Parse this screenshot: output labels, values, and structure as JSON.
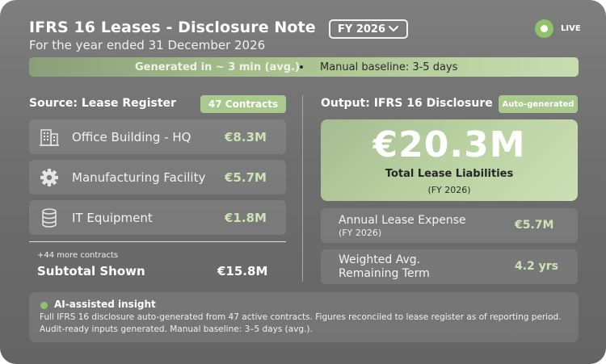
{
  "header": {
    "title": "IFRS 16 Leases - Disclosure Note",
    "subtitle": "For the year ended 31 December 2026",
    "fiscal_year_select": "FY 2026",
    "live_label": "LIVE"
  },
  "banner": {
    "generated": "Generated in ~ 3 min (avg.)",
    "manual": "Manual baseline: 3-5 days"
  },
  "source": {
    "title": "Source: Lease Register",
    "badge": "47 Contracts",
    "rows": [
      {
        "name": "Office Building - HQ",
        "value": "€8.3M",
        "icon": "building-icon"
      },
      {
        "name": "Manufacturing Facility",
        "value": "€5.7M",
        "icon": "gear-icon"
      },
      {
        "name": "IT Equipment",
        "value": "€1.8M",
        "icon": "database-icon"
      }
    ],
    "more_contracts": "+44 more contracts",
    "subtotal_label": "Subtotal Shown",
    "subtotal_value": "€15.8M"
  },
  "output": {
    "title": "Output: IFRS 16 Disclosure",
    "badge": "Auto-generated",
    "hero_value": "€20.3M",
    "hero_label": "Total Lease Liabilities",
    "hero_fy": "(FY 2026)",
    "metrics": [
      {
        "line1": "Annual Lease Expense",
        "line2": "(FY 2026)",
        "value": "€5.7M"
      },
      {
        "line1": "Weighted Avg.",
        "line2": "Remaining Term",
        "value": "4.2 yrs"
      }
    ]
  },
  "insight": {
    "heading": "AI-assisted insight",
    "body": "Full IFRS 16 disclosure auto-generated from 47 active contracts. Figures reconciled to lease register as of reporting period. Audit-ready inputs generated. Manual baseline: 3–5 days (avg.)."
  },
  "colors": {
    "accent": "#a9c98f",
    "value_green": "#cde3b6",
    "live_green": "#8fc36a"
  }
}
